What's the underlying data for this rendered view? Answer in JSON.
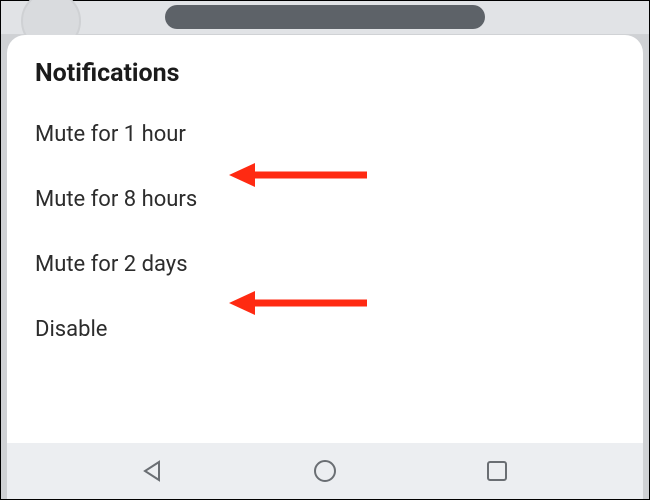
{
  "sheet": {
    "title": "Notifications",
    "options": [
      {
        "label": "Mute for 1 hour"
      },
      {
        "label": "Mute for 8 hours"
      },
      {
        "label": "Mute for 2 days"
      },
      {
        "label": "Disable"
      }
    ]
  },
  "annotations": {
    "arrow_color": "#ff2a12",
    "arrows": [
      {
        "target_option_index": 1
      },
      {
        "target_option_index": 3
      }
    ]
  }
}
